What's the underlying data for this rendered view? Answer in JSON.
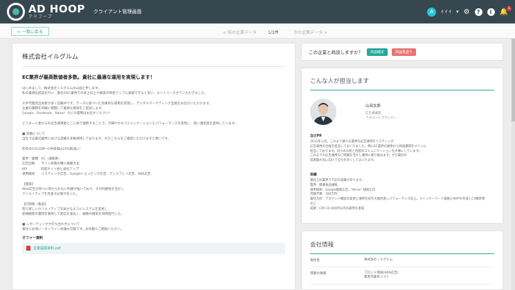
{
  "header": {
    "logo_big": "AD HOOP",
    "logo_small": "アドフープ",
    "app_title": "クライアント管理画面",
    "avatar_letter": "A",
    "user_text": "ｲ  ｲ  ｲ",
    "dropdown_glyph": "▾",
    "gear_glyph": "⚙",
    "help_glyph": "?",
    "info_glyph": "i",
    "bell_glyph": "🔔",
    "bell_badge": "1"
  },
  "subbar": {
    "back_label": "< 一覧に戻る",
    "prev_label": "< 前の企業データ",
    "page_indicator": "1/1件",
    "next_label": "次の企業データ >"
  },
  "article": {
    "company_name": "株式会社イルグルム",
    "headline": "EC業界が最高数値者多数。貴社に最適な運用を実現します！",
    "body": "はじめまして、株式会社イルグルムの山田と申します。\n私の最適化提案を行い、貴社のEC業界での売上向上や集客の改善アップに貢献できると思い、エントリーさせていただきました。\n\n大手代理店出身者が多く在籍中です。データに基づいた効果的な運用を実現し、デジタルマーケティング全般をお任せいただけます。\n企業の課題を的確に把握して最適な施策をご提案します。\nGoogle、Facebook、Yahoo！などの運用はお任せください！\n\nどうぞ一人者からの広告運用者と二人体で連携することで、き細やかなコミュニケーションとパフォーマンスを実現し、高い満足度を提供しています。\n\n■ 実績について\n当社では貴社業界における実績を多数保持しております、ぜひこちらをご確認いただけますと幸いです。\n\n昨年のCV120件→1件単価は25%削減に！\n\n業界／業種　EC（通販系）\n広告出稿　　サイト形態の購入数最大化\nKPI　　　　 何度サイト他と会社アップ\n運用媒体　　リスティング広告、Googleショッピング広告、ディスプレイ広告、SNS広告\n\n【施策】\nWeb広告が持つに寄せられない利便が強いており、その利便性を活かし\nクリエイティブを見直す必要があった。\n\n【打開策一覧表】\n有り新しいクリエイティブを試せるようにシステムを変更し、\n新規顧客の獲得を重視して配信を強化し、複数の施策を同時進行した。\n\n■ レポーティングや打ち合わせについて\n貴社にお伺い・オンライン会議も可能です。お気軽にご相談ください。"
  },
  "offer": {
    "label": "オファー資料",
    "file_name": "企業提案資料.pdf"
  },
  "interest": {
    "question": "この企業と商談しますか？",
    "yes_label": "商談確定",
    "no_label": "商談見送り"
  },
  "person": {
    "section_title": "こんな人が担当します",
    "name": "山田太郎",
    "dept": "広告事業部",
    "role": "アカウントプランナー",
    "self_pr_label": "自己PR",
    "self_pr": "2012年入社。これまで様々な業界の広告運用をリスティング\n広告運用の全般を担当してまいりました。特にEC業界の運用から商談獲得をメインに\n担当しております。日々の分析と改善のコミュニケーションを大事にしています。\nこれまでの広告運用のご経験を活かし運用に取り組みます。ぜひ貴社の\n成果最大化に向けて全力を尽くしてまいります。",
    "achievements_label": "実績",
    "achievements": "貴社と同業界で下記の実績があります。\n業界：健康食品通販\n運用媒体：Google検索広告、Yahoo！検索広告\n月額予算：300万円\n貴社方針：アカウント構造の変更と運用方式を大幅見直しパフォーマンス向上。メインキーワード発掘とMAPを作成しCV数改善\nなど\n成果：CPA 10,000円以内の運用を達成"
  },
  "company_info": {
    "section_title": "会社情報",
    "rows": [
      {
        "key": "会社名",
        "value": "株式会社イルグルム"
      },
      {
        "key": "得意な領域",
        "value": "ブロンド領域(SNS広告)\n集客作業系リスト"
      }
    ]
  }
}
